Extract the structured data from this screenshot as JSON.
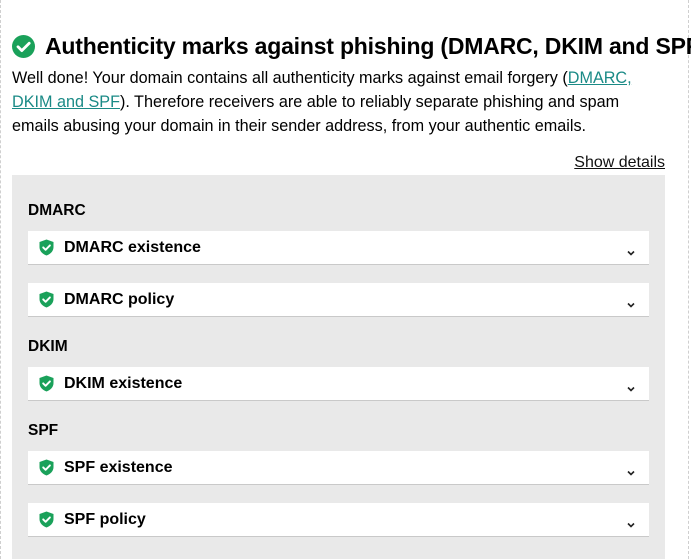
{
  "header": {
    "title": "Authenticity marks against phishing (DMARC, DKIM and SPF)",
    "status_icon": "check-circle-icon",
    "status_color": "#1aa15a"
  },
  "intro": {
    "text_before_link": "Well done! Your domain contains all authenticity marks against email forgery (",
    "link_text": "DMARC, DKIM and SPF",
    "text_after_link": "). Therefore receivers are able to reliably separate phishing and spam emails abusing your domain in their sender address, from your authentic emails."
  },
  "show_details_label": "Show details",
  "sections": [
    {
      "label": "DMARC",
      "items": [
        {
          "label": "DMARC existence",
          "icon": "shield-check-icon"
        },
        {
          "label": "DMARC policy",
          "icon": "shield-check-icon"
        }
      ]
    },
    {
      "label": "DKIM",
      "items": [
        {
          "label": "DKIM existence",
          "icon": "shield-check-icon"
        }
      ]
    },
    {
      "label": "SPF",
      "items": [
        {
          "label": "SPF existence",
          "icon": "shield-check-icon"
        },
        {
          "label": "SPF policy",
          "icon": "shield-check-icon"
        }
      ]
    }
  ],
  "colors": {
    "success": "#1aa15a",
    "link": "#1a8a86",
    "panel_background": "#e9e9e9"
  }
}
